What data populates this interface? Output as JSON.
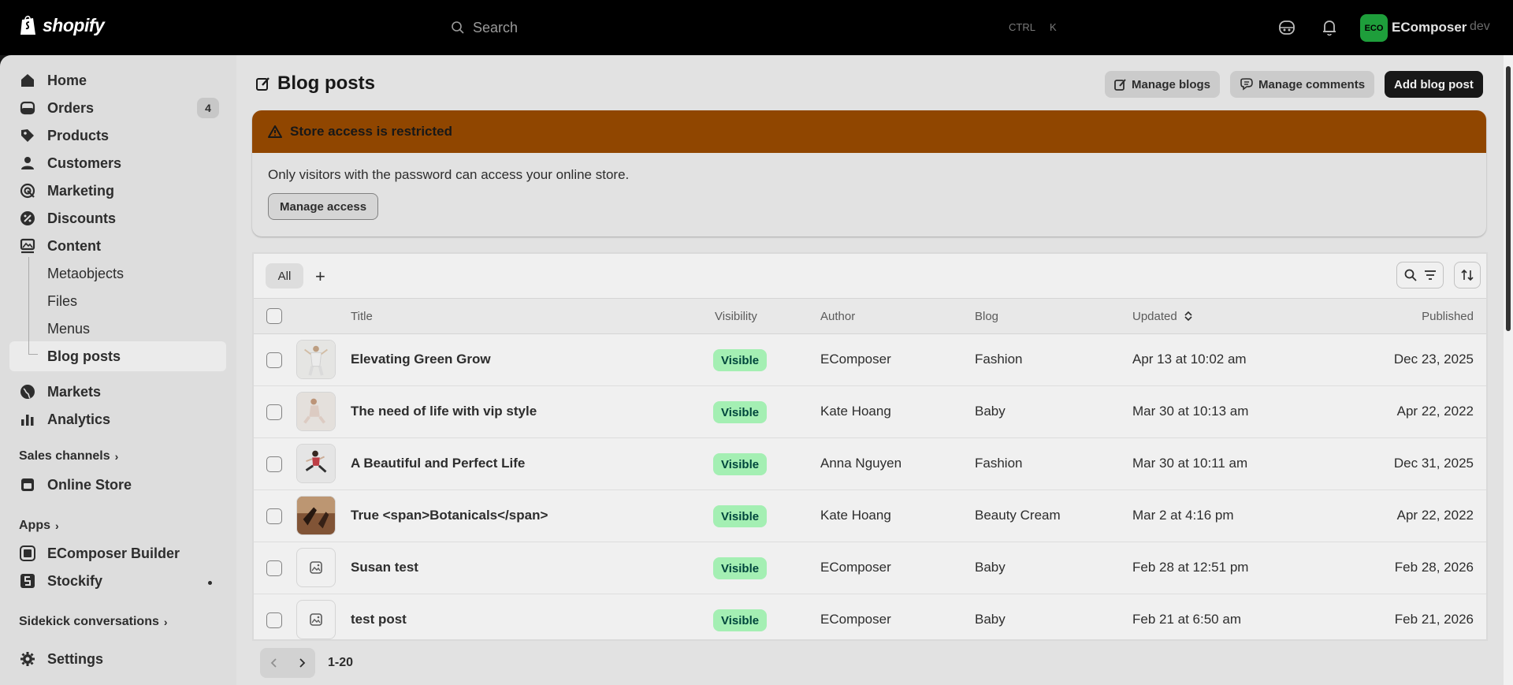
{
  "topbar": {
    "logo_text": "shopify",
    "search_placeholder": "Search",
    "kbd_ctrl": "CTRL",
    "kbd_k": "K",
    "avatar_text": "ECO",
    "store_name": "EComposer",
    "store_suffix": "dev",
    "icons": [
      "assistant-icon",
      "bell-icon"
    ]
  },
  "sidebar": {
    "items": [
      {
        "label": "Home",
        "icon": "home-icon"
      },
      {
        "label": "Orders",
        "icon": "orders-icon",
        "badge": "4"
      },
      {
        "label": "Products",
        "icon": "tag-icon"
      },
      {
        "label": "Customers",
        "icon": "person-icon"
      },
      {
        "label": "Marketing",
        "icon": "target-icon"
      },
      {
        "label": "Discounts",
        "icon": "discount-icon"
      },
      {
        "label": "Content",
        "icon": "content-icon"
      }
    ],
    "content_sub": [
      "Metaobjects",
      "Files",
      "Menus",
      "Blog posts"
    ],
    "items2": [
      {
        "label": "Markets",
        "icon": "globe-icon"
      },
      {
        "label": "Analytics",
        "icon": "chart-icon"
      }
    ],
    "sales_channels_label": "Sales channels",
    "online_store": "Online Store",
    "apps_label": "Apps",
    "apps": [
      "EComposer Builder",
      "Stockify"
    ],
    "sidekick_label": "Sidekick conversations",
    "settings": "Settings"
  },
  "page": {
    "title": "Blog posts",
    "manage_blogs": "Manage blogs",
    "manage_comments": "Manage comments",
    "add_blog_post": "Add blog post"
  },
  "banner": {
    "title": "Store access is restricted",
    "text": "Only visitors with the password can access your online store.",
    "button": "Manage access",
    "color": "#9a4b00"
  },
  "table": {
    "tab_all": "All",
    "tab_add": "+",
    "headers": {
      "title": "Title",
      "visibility": "Visibility",
      "author": "Author",
      "blog": "Blog",
      "updated": "Updated",
      "published": "Published"
    },
    "rows": [
      {
        "title": "Elevating Green Grow",
        "visibility": "Visible",
        "author": "EComposer",
        "blog": "Fashion",
        "updated": "Apr 13 at 10:02 am",
        "published": "Dec 23, 2025"
      },
      {
        "title": "The need of life with vip style",
        "visibility": "Visible",
        "author": "Kate Hoang",
        "blog": "Baby",
        "updated": "Mar 30 at 10:13 am",
        "published": "Apr 22, 2022"
      },
      {
        "title": "A Beautiful and Perfect Life",
        "visibility": "Visible",
        "author": "Anna Nguyen",
        "blog": "Fashion",
        "updated": "Mar 30 at 10:11 am",
        "published": "Dec 31, 2025"
      },
      {
        "title": "True <span>Botanicals</span>",
        "visibility": "Visible",
        "author": "Kate Hoang",
        "blog": "Beauty Cream",
        "updated": "Mar 2 at 4:16 pm",
        "published": "Apr 22, 2022"
      },
      {
        "title": "Susan test",
        "visibility": "Visible",
        "author": "EComposer",
        "blog": "Baby",
        "updated": "Feb 28 at 12:51 pm",
        "published": "Feb 28, 2026"
      },
      {
        "title": "test post",
        "visibility": "Visible",
        "author": "EComposer",
        "blog": "Baby",
        "updated": "Feb 21 at 6:50 am",
        "published": "Feb 21, 2026"
      }
    ],
    "pagination_label": "1-20"
  }
}
